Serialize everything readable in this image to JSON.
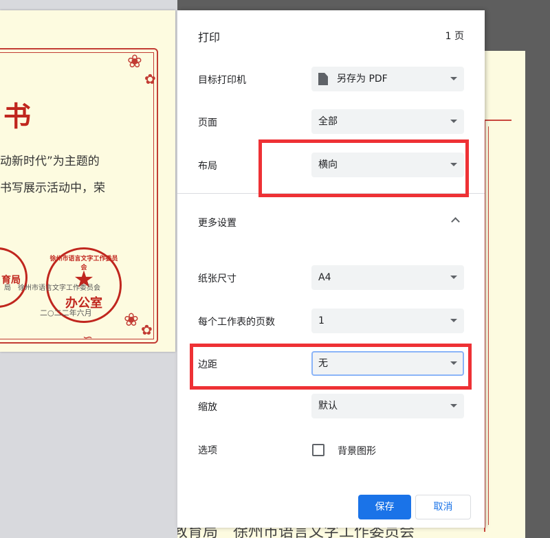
{
  "dialog": {
    "title": "打印",
    "page_count": "1 页",
    "destination": {
      "label": "目标打印机",
      "value": "另存为 PDF",
      "icon": "file-icon"
    },
    "pages": {
      "label": "页面",
      "value": "全部"
    },
    "layout": {
      "label": "布局",
      "value": "横向"
    },
    "more_settings": {
      "label": "更多设置",
      "icon": "chevron-up-icon",
      "expanded": true
    },
    "paper_size": {
      "label": "纸张尺寸",
      "value": "A4"
    },
    "pages_per_sheet": {
      "label": "每个工作表的页数",
      "value": "1"
    },
    "margins": {
      "label": "边距",
      "value": "无"
    },
    "scale": {
      "label": "缩放",
      "value": "默认"
    },
    "options": {
      "label": "选项",
      "checkbox_label": "背景图形",
      "checked": false
    },
    "save_label": "保存",
    "cancel_label": "取消"
  },
  "preview": {
    "title_char": "书",
    "line1": "动新时代”为主题的",
    "line2": "书写展示活动中，荣",
    "seal1_ring": "育局",
    "seal2_ring": "徐州市语言文字工作委员会",
    "seal2_office": "办公室",
    "footer1": "徐州市语言文字工作委员会",
    "footer2": "二○二二年六月"
  },
  "background_doc": {
    "bottom_text": "徐州市教育局　徐州市语言文字工作委员会"
  },
  "colors": {
    "primary": "#1a73e8",
    "annotation": "#ee3135",
    "seal_red": "#c0261e",
    "paper": "#fdfbe0"
  }
}
